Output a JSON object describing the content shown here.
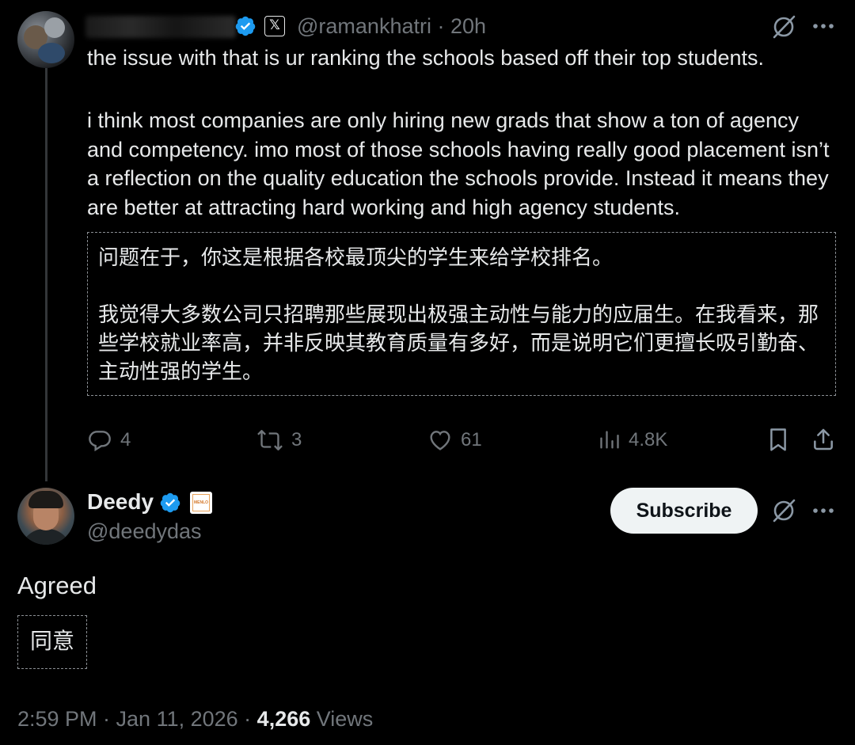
{
  "reply": {
    "handle": "@ramankhatri",
    "separator": "·",
    "time": "20h",
    "clipped_text": "the issue with that is ur ranking the schools based off their top students.",
    "body": "i think most companies are only hiring new grads that show a ton of agency and competency. imo most of those schools having really good placement isn’t a reflection on the quality education the schools provide. Instead it means they are better at attracting hard working and high agency students.",
    "translation_line1": "问题在于，你这是根据各校最顶尖的学生来给学校排名。",
    "translation_line2": "我觉得大多数公司只招聘那些展现出极强主动性与能力的应届生。在我看来，那些学校就业率高，并非反映其教育质量有多好，而是说明它们更擅长吸引勤奋、主动性强的学生。",
    "actions": {
      "replies": "4",
      "reposts": "3",
      "likes": "61",
      "views": "4.8K"
    }
  },
  "main": {
    "name": "Deedy",
    "handle": "@deedydas",
    "affiliation_badge": "MENLO",
    "subscribe_label": "Subscribe",
    "text": "Agreed",
    "translation": "同意",
    "timestamp": "2:59 PM · Jan 11, 2026 · ",
    "views_count": "4,266",
    "views_label": " Views"
  },
  "colors": {
    "background": "#000000",
    "text": "#e7e9ea",
    "muted": "#71767b",
    "verified": "#1d9bf0"
  }
}
